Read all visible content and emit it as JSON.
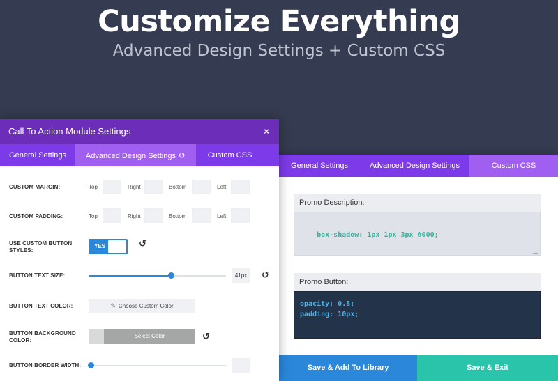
{
  "hero": {
    "title": "Customize Everything",
    "subtitle": "Advanced Design Settings + Custom CSS"
  },
  "back_panel": {
    "tabs": [
      {
        "label": "General Settings",
        "active": false
      },
      {
        "label": "Advanced Design Settings",
        "active": false
      },
      {
        "label": "Custom CSS",
        "active": true
      }
    ],
    "promo_description": {
      "label": "Promo Description:",
      "code": "box-shadow: 1px 1px 3px #000;"
    },
    "promo_button": {
      "label": "Promo Button:",
      "code_line1": "opacity: 0.8;",
      "code_line2": "padding: 10px;"
    },
    "buttons": {
      "library": "Save & Add To Library",
      "exit": "Save & Exit"
    }
  },
  "modal": {
    "title": "Call To Action Module Settings",
    "close_glyph": "×",
    "tabs": [
      {
        "label": "General Settings",
        "active": false
      },
      {
        "label": "Advanced Design Settings",
        "active": true
      },
      {
        "label": "Custom CSS",
        "active": false
      }
    ],
    "reset_glyph": "↺",
    "fields": {
      "custom_margin": {
        "label": "CUSTOM MARGIN:",
        "top": "Top",
        "right": "Right",
        "bottom": "Bottom",
        "left": "Left"
      },
      "custom_padding": {
        "label": "CUSTOM PADDING:",
        "top": "Top",
        "right": "Right",
        "bottom": "Bottom",
        "left": "Left"
      },
      "custom_button_styles": {
        "label_line1": "USE CUSTOM BUTTON",
        "label_line2": "STYLES:",
        "toggle_text": "YES",
        "enabled": true
      },
      "button_text_size": {
        "label": "BUTTON TEXT SIZE:",
        "value": "41px",
        "slider_fraction": 0.6
      },
      "button_text_color": {
        "label": "BUTTON TEXT COLOR:",
        "button": "Choose Custom Color",
        "eyedropper_icon": "✎"
      },
      "button_background_color": {
        "label_line1": "BUTTON BACKGROUND",
        "label_line2": "COLOR:",
        "button": "Select Color"
      },
      "button_border_width": {
        "label": "BUTTON BORDER WIDTH:",
        "slider_fraction": 0.02
      }
    }
  },
  "colors": {
    "background": "#353b50",
    "purple_header": "#6c2eb9",
    "purple_tabs": "#7d3ae8",
    "purple_tab_active": "#a15ff2",
    "blue_accent": "#2b87da",
    "teal_accent": "#29c4a9"
  }
}
